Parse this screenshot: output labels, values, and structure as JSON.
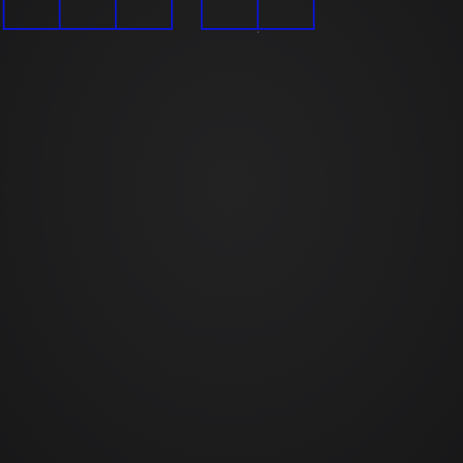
{
  "colors": {
    "background": "#1c1c1d",
    "box_outline": "#0a14d6"
  },
  "groups": [
    {
      "boxes": 3
    },
    {
      "boxes": 2
    }
  ]
}
